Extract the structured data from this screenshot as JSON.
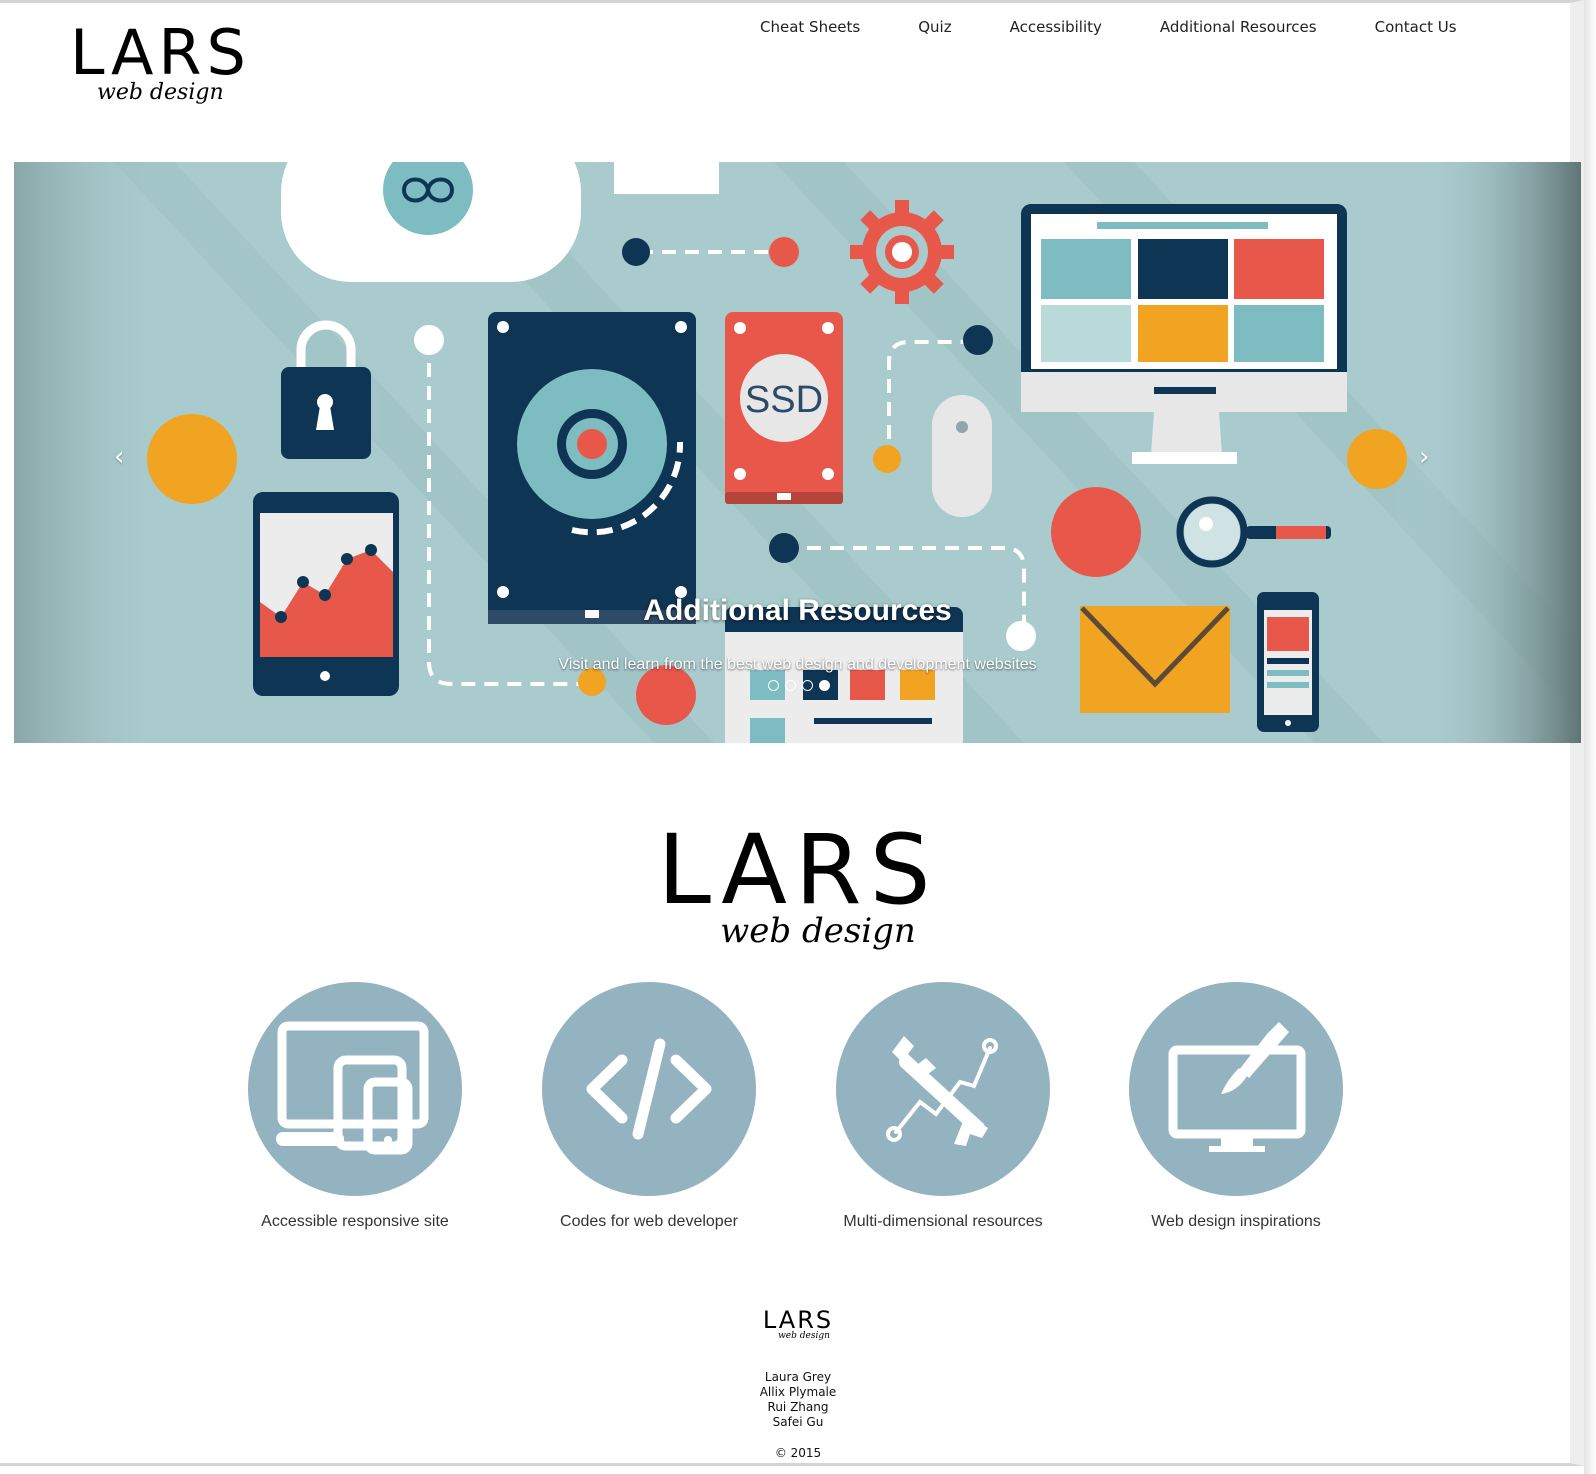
{
  "brand": {
    "name": "LARS",
    "tagline": "web design"
  },
  "nav": {
    "items": [
      {
        "label": "Cheat Sheets"
      },
      {
        "label": "Quiz"
      },
      {
        "label": "Accessibility"
      },
      {
        "label": "Additional Resources"
      },
      {
        "label": "Contact Us"
      }
    ]
  },
  "carousel": {
    "title": "Additional Resources",
    "subtitle": "Visit and learn from the best web design and development websites",
    "prev_icon": "chevron-left-icon",
    "next_icon": "chevron-right-icon",
    "prev_glyph": "‹",
    "next_glyph": "›",
    "slide_count": 4,
    "active_slide": 4,
    "illustration_text": "SSD",
    "colors": {
      "background": "#a9cbcd",
      "navy": "#0f3555",
      "red": "#e8584a",
      "orange": "#f1a322",
      "teal": "#7dbcc0",
      "white": "#ffffff"
    }
  },
  "features": [
    {
      "icon": "responsive-devices-icon",
      "label": "Accessible responsive site"
    },
    {
      "icon": "code-icon",
      "label": "Codes for web developer"
    },
    {
      "icon": "tools-icon",
      "label": "Multi-dimensional resources"
    },
    {
      "icon": "monitor-pen-icon",
      "label": "Web design inspirations"
    }
  ],
  "feature_circle_color": "#94b3c0",
  "footer": {
    "authors": [
      "Laura Grey",
      "Allix Plymale",
      "Rui Zhang",
      "Safei Gu"
    ],
    "copyright": "© 2015"
  }
}
